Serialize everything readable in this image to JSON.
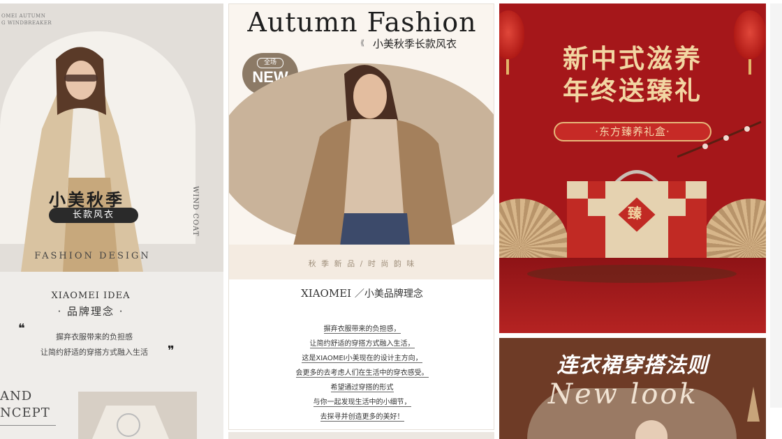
{
  "card1": {
    "header_line1": "OMEI AUTUMN",
    "header_line2": "G WINDBREAKER",
    "headline": "小美秋季",
    "tag": "长款风衣",
    "side_text": "WIND COAT",
    "fashion_design": "FASHION DESIGN",
    "idea_title": "XIAOMEI IDEA",
    "idea_subtitle": "· 品牌理念 ·",
    "quote_line1": "摒弃衣服带来的负担感",
    "quote_line2": "让简约舒适的穿搭方式融入生活",
    "footer_line1": "AND",
    "footer_line2": "NCEPT"
  },
  "card2": {
    "title": "Autumn Fashion",
    "subtitle": "小美秋季长款风衣",
    "badge_top": "全场",
    "badge_main": "NEW",
    "tagline": "秋 季 新 品   /   时 尚 韵 味",
    "brand_heading": "XIAOMEI",
    "brand_heading_sub": "／小美品牌理念",
    "body_lines": [
      "摒弃衣服带来的负担感，",
      "让简约舒适的穿搭方式融入生活，",
      "这是XIAOMEI小美现在的设计主方向，",
      "会更多的去考虑人们在生活中的穿衣感受。",
      "希望通过穿搭的形式",
      "与你一起发现生活中的小细节，",
      "去探寻并创造更多的美好！"
    ]
  },
  "card3": {
    "headline1": "新中式滋养",
    "headline2": "年终送臻礼",
    "ribbon": "·东方臻养礼盒·",
    "box_char": "臻"
  },
  "card4": {
    "headline": "连衣裙穿搭法则",
    "script_text": "New look"
  },
  "colors": {
    "card3_red": "#a5171a",
    "gold": "#f2d6a2",
    "card4_brown": "#6e3b26",
    "card2_beige": "#c9b39a"
  }
}
